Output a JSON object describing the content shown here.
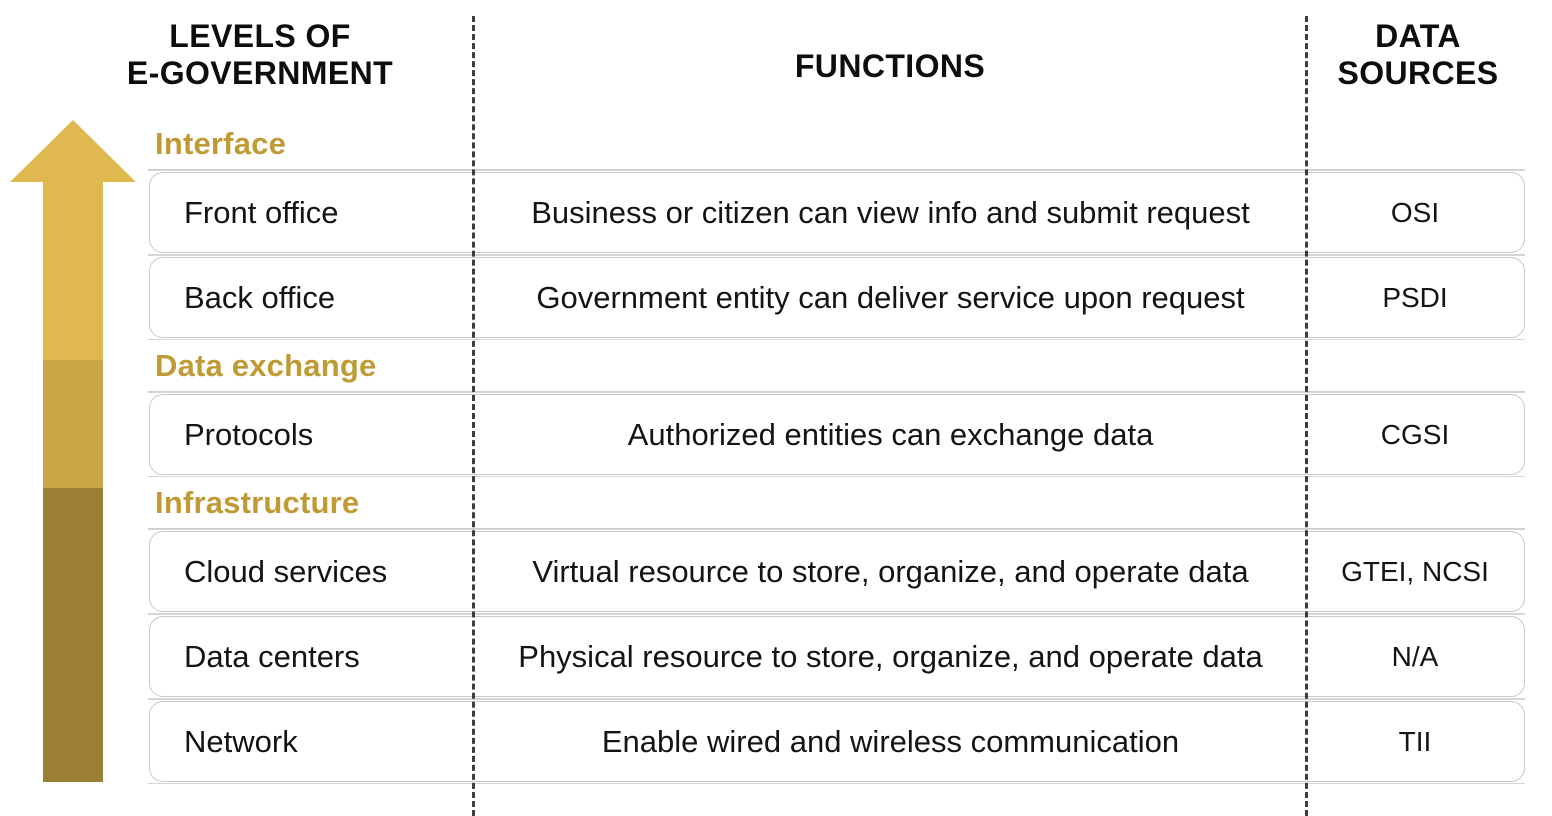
{
  "headers": {
    "levels": "LEVELS OF E-GOVERNMENT",
    "levels_line1": "LEVELS OF",
    "levels_line2": "E-GOVERNMENT",
    "functions": "FUNCTIONS",
    "sources_line1": "DATA",
    "sources_line2": "SOURCES"
  },
  "colors": {
    "group_label": "#c09a34",
    "arrow_top": "#dfb950",
    "arrow_mid": "#cca546",
    "arrow_bottom": "#9b7f34",
    "row_border": "#c9c9c9",
    "dash_line": "#3d3d3d",
    "text": "#141414"
  },
  "groups": [
    {
      "label": "Interface",
      "rows": [
        {
          "level": "Front office",
          "function": "Business or citizen can view info and submit request",
          "source": "OSI"
        },
        {
          "level": "Back office",
          "function": "Government entity can deliver service upon request",
          "source": "PSDI"
        }
      ]
    },
    {
      "label": "Data exchange",
      "rows": [
        {
          "level": "Protocols",
          "function": "Authorized entities can exchange data",
          "source": "CGSI"
        }
      ]
    },
    {
      "label": "Infrastructure",
      "rows": [
        {
          "level": "Cloud services",
          "function": "Virtual resource to store, organize, and operate data",
          "source": "GTEI, NCSI"
        },
        {
          "level": "Data centers",
          "function": "Physical resource to store, organize, and operate data",
          "source": "N/A"
        },
        {
          "level": "Network",
          "function": "Enable wired and wireless communication",
          "source": "TII"
        }
      ]
    }
  ],
  "arrow": {
    "name": "upward-maturity-arrow",
    "segments": [
      {
        "name": "interface-segment",
        "color": "#dfb950"
      },
      {
        "name": "data-exchange-segment",
        "color": "#cca546"
      },
      {
        "name": "infrastructure-segment",
        "color": "#9b7f34"
      }
    ]
  }
}
